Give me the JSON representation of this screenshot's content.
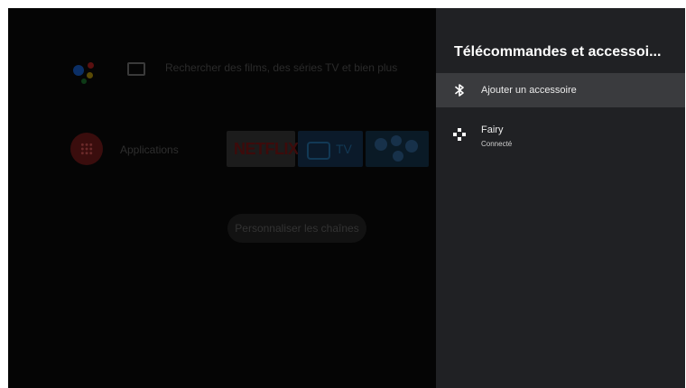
{
  "home": {
    "search_placeholder": "Rechercher des films, des séries TV et bien plus",
    "apps_label": "Applications",
    "tiles": [
      {
        "name": "netflix",
        "label": "NETFLIX"
      },
      {
        "name": "tv",
        "label": "TV"
      },
      {
        "name": "games",
        "label": ""
      }
    ],
    "customize_label": "Personnaliser les chaînes"
  },
  "panel": {
    "title": "Télécommandes et accessoi...",
    "items": [
      {
        "label": "Ajouter un accessoire",
        "icon": "bluetooth-icon",
        "selected": true
      },
      {
        "label": "Fairy",
        "status": "Connecté",
        "icon": "gamepad-icon",
        "selected": false
      }
    ]
  },
  "colors": {
    "panel_bg": "#202124",
    "selected_row": "#3a3b3e",
    "screen_bg": "#000000"
  }
}
